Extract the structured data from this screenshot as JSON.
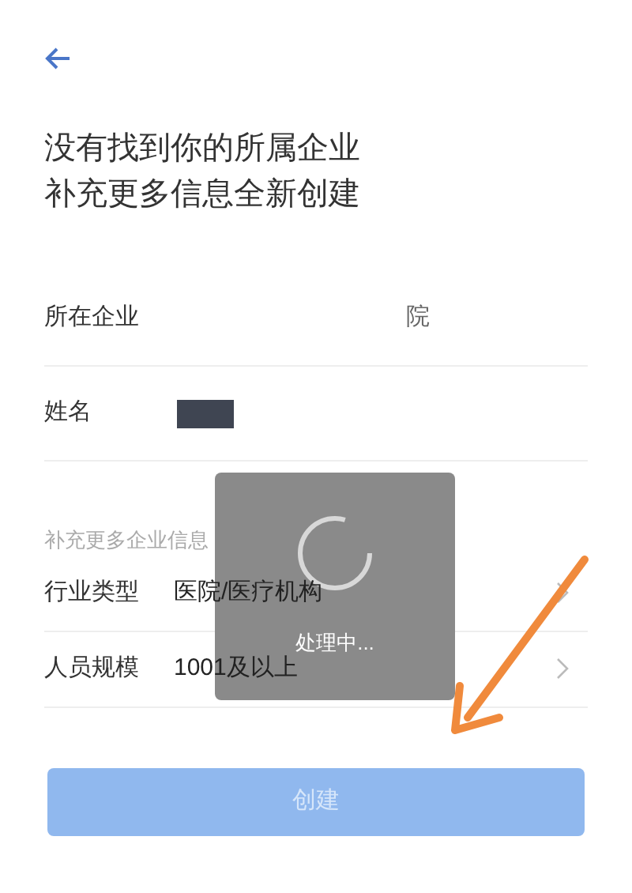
{
  "title_lines": [
    "没有找到你的所属企业",
    "补充更多信息全新创建"
  ],
  "fields": [
    {
      "label": "所在企业",
      "value": "院",
      "redacted": false
    },
    {
      "label": "姓名",
      "redacted": true
    }
  ],
  "section_label": "补充更多企业信息",
  "options": [
    {
      "label": "行业类型",
      "value": "医院/医疗机构"
    },
    {
      "label": "人员规模",
      "value": "1001及以上"
    }
  ],
  "create_button": {
    "label": "创建",
    "disabled": true
  },
  "toast": {
    "text": "处理中..."
  }
}
